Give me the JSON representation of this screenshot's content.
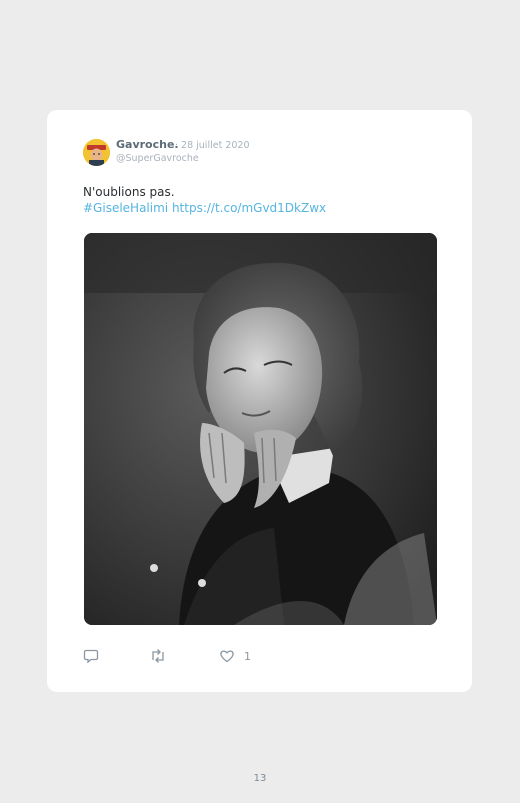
{
  "tweet": {
    "author_name": "Gavroche.",
    "date": "· 28 juillet 2020",
    "handle": "@SuperGavroche",
    "text": "N'oublions pas.",
    "hashtag": "#GiseleHalimi",
    "url": "https://t.co/mGvd1DkZwx",
    "like_count": "1"
  },
  "icons": {
    "avatar": "avatar-image",
    "reply": "reply-icon",
    "retweet": "retweet-icon",
    "like": "heart-icon"
  },
  "colors": {
    "link": "#55b4e0",
    "avatar_background": "#f2c230"
  },
  "page": {
    "number": "13"
  }
}
